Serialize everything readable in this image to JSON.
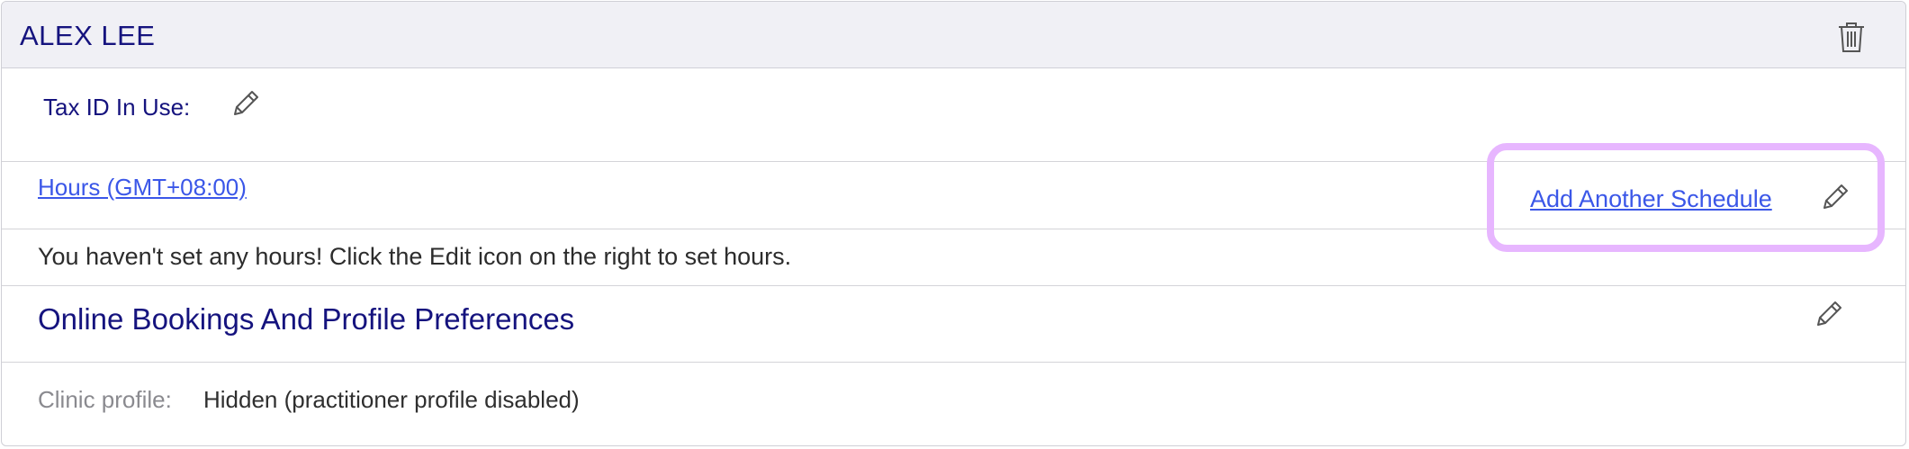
{
  "practitioner": {
    "name": "ALEX LEE"
  },
  "tax": {
    "label": "Tax ID In Use:"
  },
  "hours": {
    "link_label": "Hours (GMT+08:00)",
    "add_schedule_label": "Add Another Schedule",
    "empty_message": "You haven't set any hours! Click the Edit icon on the right to set hours."
  },
  "online": {
    "title": "Online Bookings And Profile Preferences"
  },
  "clinic": {
    "label": "Clinic profile:",
    "value": "Hidden (practitioner profile disabled)"
  },
  "icons": [
    "trash-icon",
    "pencil-icon"
  ],
  "colors": {
    "title": "#15137e",
    "link": "#3b57e8",
    "highlight": "#e7b6ff"
  }
}
